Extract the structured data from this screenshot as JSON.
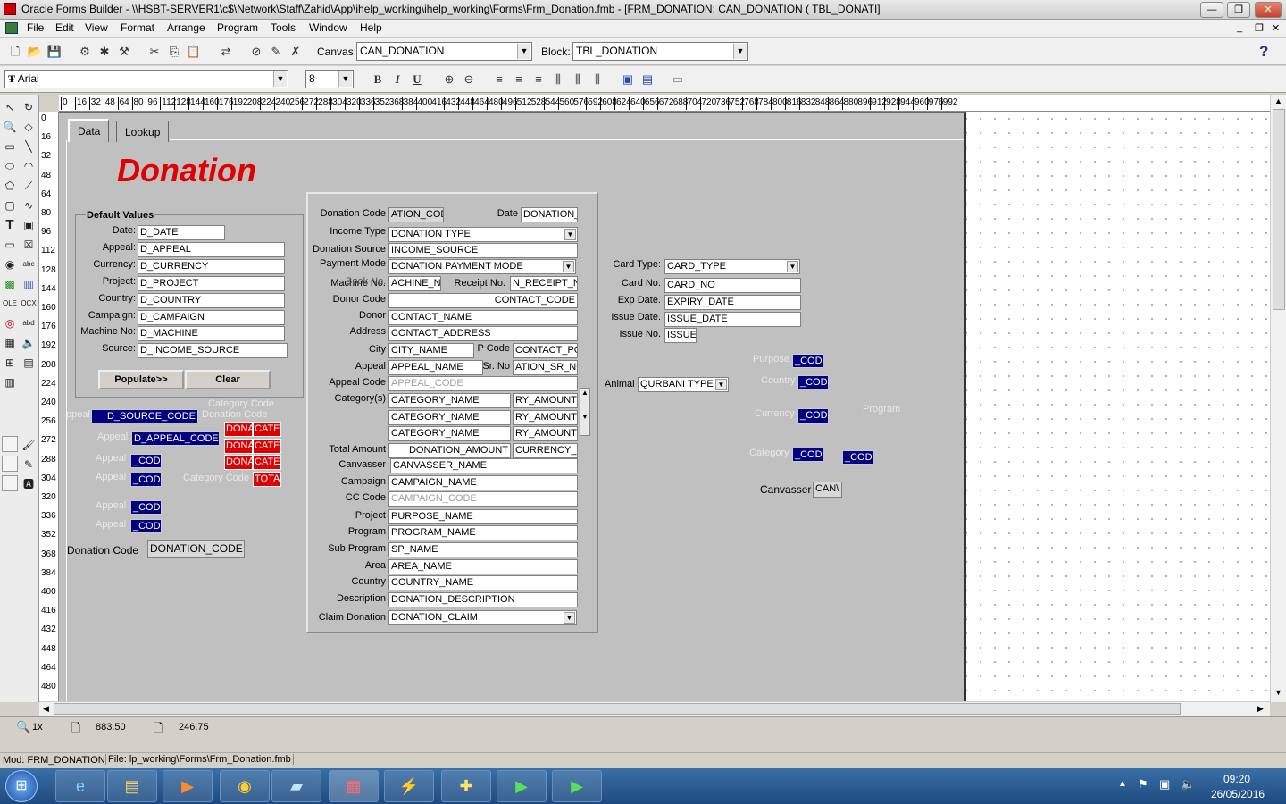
{
  "window": {
    "title": "Oracle Forms Builder - \\\\HSBT-SERVER1\\c$\\Network\\Staff\\Zahid\\App\\ihelp_working\\ihelp_working\\Forms\\Frm_Donation.fmb - [FRM_DONATION: CAN_DONATION ( TBL_DONATI]"
  },
  "menu": [
    "File",
    "Edit",
    "View",
    "Format",
    "Arrange",
    "Program",
    "Tools",
    "Window",
    "Help"
  ],
  "toolbar": {
    "canvas_label": "Canvas:",
    "canvas_value": "CAN_DONATION",
    "block_label": "Block:",
    "block_value": "TBL_DONATION",
    "help": "?"
  },
  "fontbar": {
    "font": "Arial",
    "size": "8",
    "bold": "B",
    "italic": "I",
    "underline": "U"
  },
  "ruler": {
    "h": [
      "0",
      "16",
      "32",
      "48",
      "64",
      "80",
      "96",
      "112",
      "128",
      "144",
      "160",
      "176",
      "192",
      "208",
      "224",
      "240",
      "256",
      "272",
      "288",
      "304",
      "320",
      "336",
      "352",
      "368",
      "384",
      "400",
      "416",
      "432",
      "448",
      "464",
      "480",
      "496",
      "512",
      "528",
      "544",
      "560",
      "576",
      "592",
      "608",
      "624",
      "640",
      "656",
      "672",
      "688",
      "704",
      "720",
      "736",
      "752",
      "768",
      "784",
      "800",
      "816",
      "832",
      "848",
      "864",
      "880",
      "896",
      "912",
      "928",
      "944",
      "960",
      "976",
      "992"
    ],
    "v": [
      "0",
      "16",
      "32",
      "48",
      "64",
      "80",
      "96",
      "112",
      "128",
      "144",
      "160",
      "176",
      "192",
      "208",
      "224",
      "240",
      "256",
      "272",
      "288",
      "304",
      "320",
      "336",
      "352",
      "368",
      "384",
      "400",
      "416",
      "432",
      "448",
      "464",
      "480"
    ]
  },
  "tabs": [
    "Data",
    "Lookup"
  ],
  "heading": "Donation",
  "defaults": {
    "title": "Default Values",
    "rows": [
      {
        "label": "Date:",
        "value": "D_DATE"
      },
      {
        "label": "Appeal:",
        "value": "D_APPEAL"
      },
      {
        "label": "Currency:",
        "value": "D_CURRENCY"
      },
      {
        "label": "Project:",
        "value": "D_PROJECT"
      },
      {
        "label": "Country:",
        "value": "D_COUNTRY"
      },
      {
        "label": "Campaign:",
        "value": "D_CAMPAIGN"
      },
      {
        "label": "Machine No:",
        "value": "D_MACHINE"
      },
      {
        "label": "Source:",
        "value": "D_INCOME_SOURCE"
      }
    ],
    "populate": "Populate>>",
    "clear": "Clear"
  },
  "lookup_left": {
    "category_code": "Category Code",
    "donation_code_ghost": "Donation Code",
    "ppeal": "ppeal",
    "source_code": "D_SOURCE_CODE",
    "appeal_label": "Appeal",
    "appeal_code": "D_APPEAL_CODE",
    "code": "_CODE",
    "category_code2": "Category Code",
    "dona": "DONA",
    "cate": "CATE",
    "tota": "TOTA",
    "donation_code_label": "Donation Code",
    "donation_code_value": "DONATION_CODE"
  },
  "main": {
    "donation_code_label": "Donation Code",
    "donation_code": "ATION_CODE",
    "date_label": "Date",
    "date": "DONATION_D",
    "income_type_label": "Income Type",
    "income_type": "DONATION TYPE",
    "donation_source_label": "Donation Source",
    "income_source": "INCOME_SOURCE",
    "payment_mode_label": "Payment Mode",
    "payment_mode": "DONATION PAYMENT MODE",
    "machine_label": "Machine No.",
    "book_label": "Book No.",
    "machine": "ACHINE_NO",
    "receipt_label": "Receipt No.",
    "receipt": "N_RECEIPT_NO",
    "donor_code_label": "Donor Code",
    "contact_code": "CONTACT_CODE",
    "donor_label": "Donor",
    "contact_name": "CONTACT_NAME",
    "address_label": "Address",
    "contact_address": "CONTACT_ADDRESS",
    "city_label": "City",
    "city": "CITY_NAME",
    "pcode_label": "P Code",
    "pcode": "CONTACT_PCO",
    "appeal_label": "Appeal",
    "appeal": "APPEAL_NAME",
    "srno_label": "Sr. No",
    "srno": "ATION_SR_NO",
    "appeal_code_label": "Appeal Code",
    "appeal_code": "APPEAL_CODE",
    "categories_label": "Category(s)",
    "category_name": "CATEGORY_NAME",
    "ry_amount": "RY_AMOUNT",
    "total_label": "Total Amount",
    "donation_amount": "DONATION_AMOUNT",
    "currency": "CURRENCY_N",
    "canvasser_label": "Canvasser",
    "canvasser": "CANVASSER_NAME",
    "campaign_label": "Campaign",
    "campaign": "CAMPAIGN_NAME",
    "cc_label": "CC Code",
    "cc": "CAMPAIGN_CODE",
    "project_label": "Project",
    "project": "PURPOSE_NAME",
    "program_label": "Program",
    "program": "PROGRAM_NAME",
    "subprogram_label": "Sub Program",
    "subprogram": "SP_NAME",
    "area_label": "Area",
    "area": "AREA_NAME",
    "country_label": "Country",
    "country": "COUNTRY_NAME",
    "description_label": "Description",
    "description": "DONATION_DESCRIPTION",
    "claim_label": "Claim Donation",
    "claim": "DONATION_CLAIM"
  },
  "card": {
    "type_label": "Card Type:",
    "type": "CARD_TYPE",
    "no_label": "Card No.",
    "no": "CARD_NO",
    "exp_label": "Exp Date.",
    "exp": "EXPIRY_DATE",
    "issue_date_label": "Issue Date.",
    "issue_date": "ISSUE_DATE",
    "issue_no_label": "Issue No.",
    "issue_no": "ISSUE_"
  },
  "right_lookup": {
    "animal_label": "Animal",
    "animal": "QURBANI TYPE",
    "purpose": "Purpose",
    "country": "Country",
    "currency": "Currency",
    "program": "Program",
    "category": "Category",
    "code": "_CODE",
    "canvasser_label": "Canvasser",
    "canvasser": "CAN\\"
  },
  "status": {
    "zoom": "1x",
    "x": "883.50",
    "y": "246.75"
  },
  "modbar": {
    "mod": "Mod: FRM_DONATION",
    "file": "File: lp_working\\Forms\\Frm_Donation.fmb"
  },
  "taskbar": {
    "time": "09:20",
    "date": "26/05/2016"
  }
}
